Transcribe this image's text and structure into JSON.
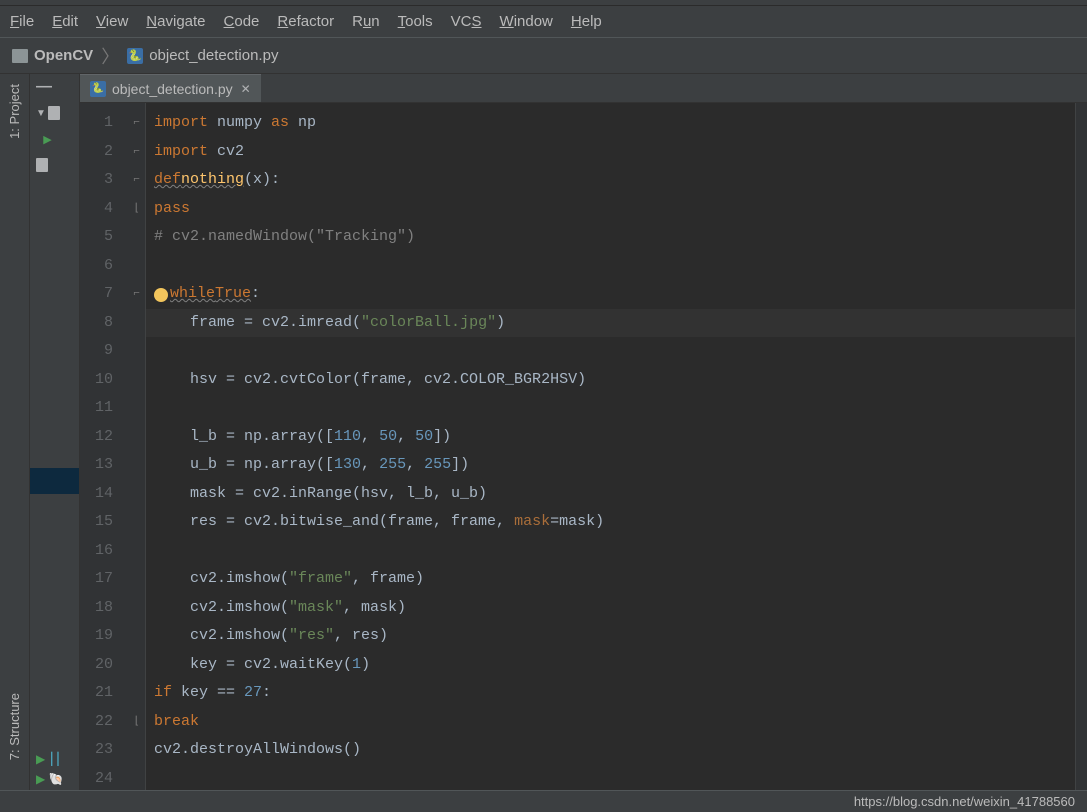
{
  "menu": [
    "File",
    "Edit",
    "View",
    "Navigate",
    "Code",
    "Refactor",
    "Run",
    "Tools",
    "VCS",
    "Window",
    "Help"
  ],
  "menu_mnemonic_idx": [
    0,
    0,
    0,
    0,
    0,
    0,
    1,
    0,
    2,
    0,
    0
  ],
  "breadcrumb": {
    "project": "OpenCV",
    "file": "object_detection.py"
  },
  "tab": {
    "label": "object_detection.py"
  },
  "left_labels": {
    "project": "1: Project",
    "structure": "7: Structure"
  },
  "status": {
    "watermark": "https://blog.csdn.net/weixin_41788560"
  },
  "code_lines": [
    {
      "n": 1,
      "tokens": [
        [
          "kw",
          "import"
        ],
        [
          "",
          ", "
        ],
        [
          "",
          "numpy "
        ],
        [
          "kw",
          "as"
        ],
        [
          "",
          ", "
        ],
        [
          "",
          "np"
        ]
      ],
      "raw": "import numpy as np"
    },
    {
      "n": 2,
      "raw": "import cv2"
    },
    {
      "n": 3,
      "raw": "def nothing(x):"
    },
    {
      "n": 4,
      "raw": "    pass"
    },
    {
      "n": 5,
      "raw": "# cv2.namedWindow(\"Tracking\")"
    },
    {
      "n": 6,
      "raw": ""
    },
    {
      "n": 7,
      "raw": "while True:"
    },
    {
      "n": 8,
      "raw": "    frame = cv2.imread(\"colorBall.jpg\")",
      "hl": true
    },
    {
      "n": 9,
      "raw": ""
    },
    {
      "n": 10,
      "raw": "    hsv = cv2.cvtColor(frame, cv2.COLOR_BGR2HSV)"
    },
    {
      "n": 11,
      "raw": ""
    },
    {
      "n": 12,
      "raw": "    l_b = np.array([110, 50, 50])"
    },
    {
      "n": 13,
      "raw": "    u_b = np.array([130, 255, 255])"
    },
    {
      "n": 14,
      "raw": "    mask = cv2.inRange(hsv, l_b, u_b)"
    },
    {
      "n": 15,
      "raw": "    res = cv2.bitwise_and(frame, frame, mask=mask)"
    },
    {
      "n": 16,
      "raw": ""
    },
    {
      "n": 17,
      "raw": "    cv2.imshow(\"frame\", frame)"
    },
    {
      "n": 18,
      "raw": "    cv2.imshow(\"mask\", mask)"
    },
    {
      "n": 19,
      "raw": "    cv2.imshow(\"res\", res)"
    },
    {
      "n": 20,
      "raw": "    key = cv2.waitKey(1)"
    },
    {
      "n": 21,
      "raw": "    if key == 27:"
    },
    {
      "n": 22,
      "raw": "        break"
    },
    {
      "n": 23,
      "raw": "cv2.destroyAllWindows()"
    },
    {
      "n": 24,
      "raw": ""
    }
  ]
}
